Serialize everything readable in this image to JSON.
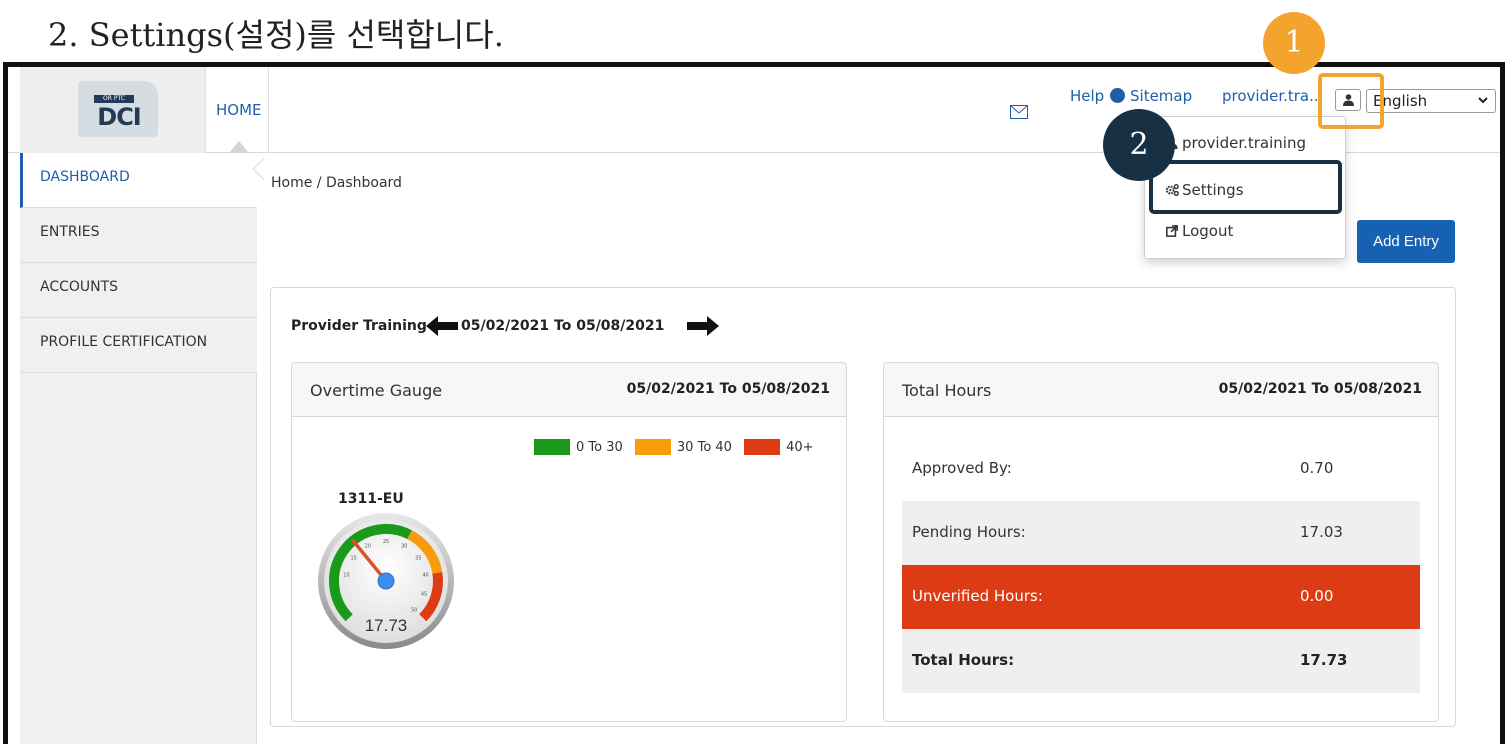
{
  "instruction": "2.  Settings(설정)를 선택합니다.",
  "header": {
    "logo_tag": "OR PTC",
    "logo_text": "DCI",
    "home": "HOME",
    "help": "Help",
    "sitemap": "Sitemap",
    "user": "provider.tra...",
    "language": "English"
  },
  "user_menu": {
    "items": [
      {
        "label": "provider.training",
        "icon": "user-icon"
      },
      {
        "label": "Settings",
        "icon": "cogs-icon"
      },
      {
        "label": "Logout",
        "icon": "logout-icon"
      }
    ]
  },
  "callouts": {
    "one": "1",
    "two": "2"
  },
  "sidebar": {
    "items": [
      {
        "label": "DASHBOARD",
        "active": true
      },
      {
        "label": "ENTRIES",
        "active": false
      },
      {
        "label": "ACCOUNTS",
        "active": false
      },
      {
        "label": "PROFILE CERTIFICATION",
        "active": false
      }
    ]
  },
  "breadcrumb": "Home / Dashboard",
  "add_entry": "Add Entry",
  "week": {
    "provider": "Provider Training",
    "range": "05/02/2021 To 05/08/2021"
  },
  "overtime": {
    "title": "Overtime Gauge",
    "range": "05/02/2021 To 05/08/2021",
    "legend": [
      {
        "label": "0 To 30",
        "color": "#1a9a1a"
      },
      {
        "label": "30 To 40",
        "color": "#f89b0c"
      },
      {
        "label": "40+",
        "color": "#dc3b14"
      }
    ],
    "gauge": {
      "id": "1311-EU",
      "value": "17.73",
      "needle_value": 17.73,
      "min": 0,
      "max": 50,
      "ticks": [
        "10",
        "15",
        "20",
        "25",
        "30",
        "35",
        "40",
        "45",
        "50"
      ]
    }
  },
  "total_hours": {
    "title": "Total Hours",
    "range": "05/02/2021 To 05/08/2021",
    "rows": [
      {
        "label": "Approved By:",
        "value": "0.70"
      },
      {
        "label": "Pending Hours:",
        "value": "17.03"
      },
      {
        "label": "Unverified Hours:",
        "value": "0.00"
      },
      {
        "label": "Total Hours:",
        "value": "17.73"
      }
    ]
  },
  "colors": {
    "link": "#1f5faa",
    "primary": "#1661b2",
    "alert": "#dc3b14",
    "callout_orange": "#f4a42c",
    "callout_navy": "#173043"
  }
}
